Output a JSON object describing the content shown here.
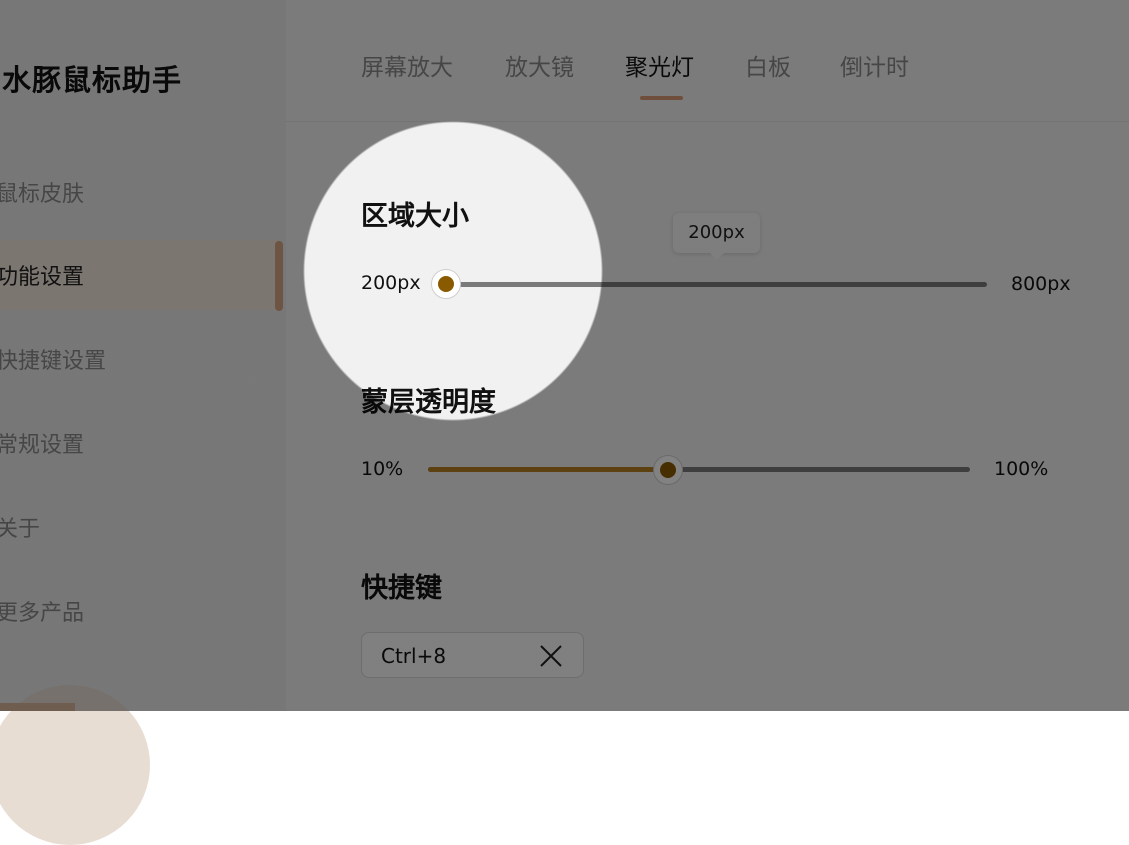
{
  "app": {
    "title": "水豚鼠标助手"
  },
  "sidebar": {
    "items": [
      {
        "label": "鼠标皮肤"
      },
      {
        "label": "功能设置"
      },
      {
        "label": "快捷键设置"
      },
      {
        "label": "常规设置"
      },
      {
        "label": "关于"
      },
      {
        "label": "更多产品"
      }
    ],
    "active_index": 1
  },
  "tabs": {
    "items": [
      {
        "label": "屏幕放大"
      },
      {
        "label": "放大镜"
      },
      {
        "label": "聚光灯"
      },
      {
        "label": "白板"
      },
      {
        "label": "倒计时"
      }
    ],
    "active_index": 2
  },
  "settings": {
    "area_size": {
      "title": "区域大小",
      "min_label": "200px",
      "max_label": "800px",
      "value": 200,
      "value_label": "200px"
    },
    "mask_opacity": {
      "title": "蒙层透明度",
      "min_label": "10%",
      "max_label": "100%",
      "value_fraction": 0.44
    },
    "shortcut": {
      "title": "快捷键",
      "value": "Ctrl+8"
    }
  },
  "colors": {
    "accent": "#d99a76",
    "slider_thumb": "#8a5a00",
    "active_nav_bg": "#f3e7de"
  },
  "icons": {
    "clear_shortcut": "close-icon"
  }
}
